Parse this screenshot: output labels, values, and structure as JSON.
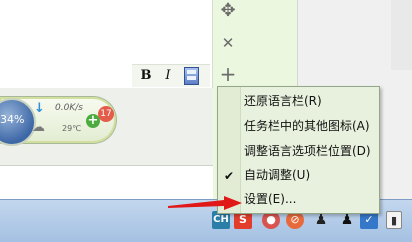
{
  "format_bar": {
    "bold_label": "B",
    "italic_label": "I"
  },
  "tools": {
    "move_symbol": "✥",
    "close_symbol": "✕",
    "add_symbol": "+"
  },
  "widget": {
    "percent_label": "34%",
    "speed_label": "0.0K/s",
    "temperature_label": "29℃",
    "notification_count": "17",
    "plus_symbol": "+"
  },
  "context_menu": {
    "items": [
      {
        "label": "还原语言栏(R)"
      },
      {
        "label": "任务栏中的其他图标(A)"
      },
      {
        "label": "调整语言选项栏位置(D)"
      },
      {
        "label": "自动调整(U)",
        "checked": true
      },
      {
        "label": "设置(E)..."
      }
    ],
    "check_symbol": "✔"
  },
  "taskbar": {
    "language_badge": "CH",
    "tray_icons": [
      "input-method-s-icon",
      "antivirus-icon",
      "security-shield-icon",
      "penguin-chat-icon",
      "penguin-chat-icon-2",
      "cloud-sync-icon",
      "action-center-icon"
    ]
  },
  "colors": {
    "menu_bg": "#e8f1dd",
    "taskbar": "#b4cbe8",
    "arrow_red": "#e01818",
    "badge_red": "#e45d4a",
    "plus_green": "#4cab3e"
  }
}
